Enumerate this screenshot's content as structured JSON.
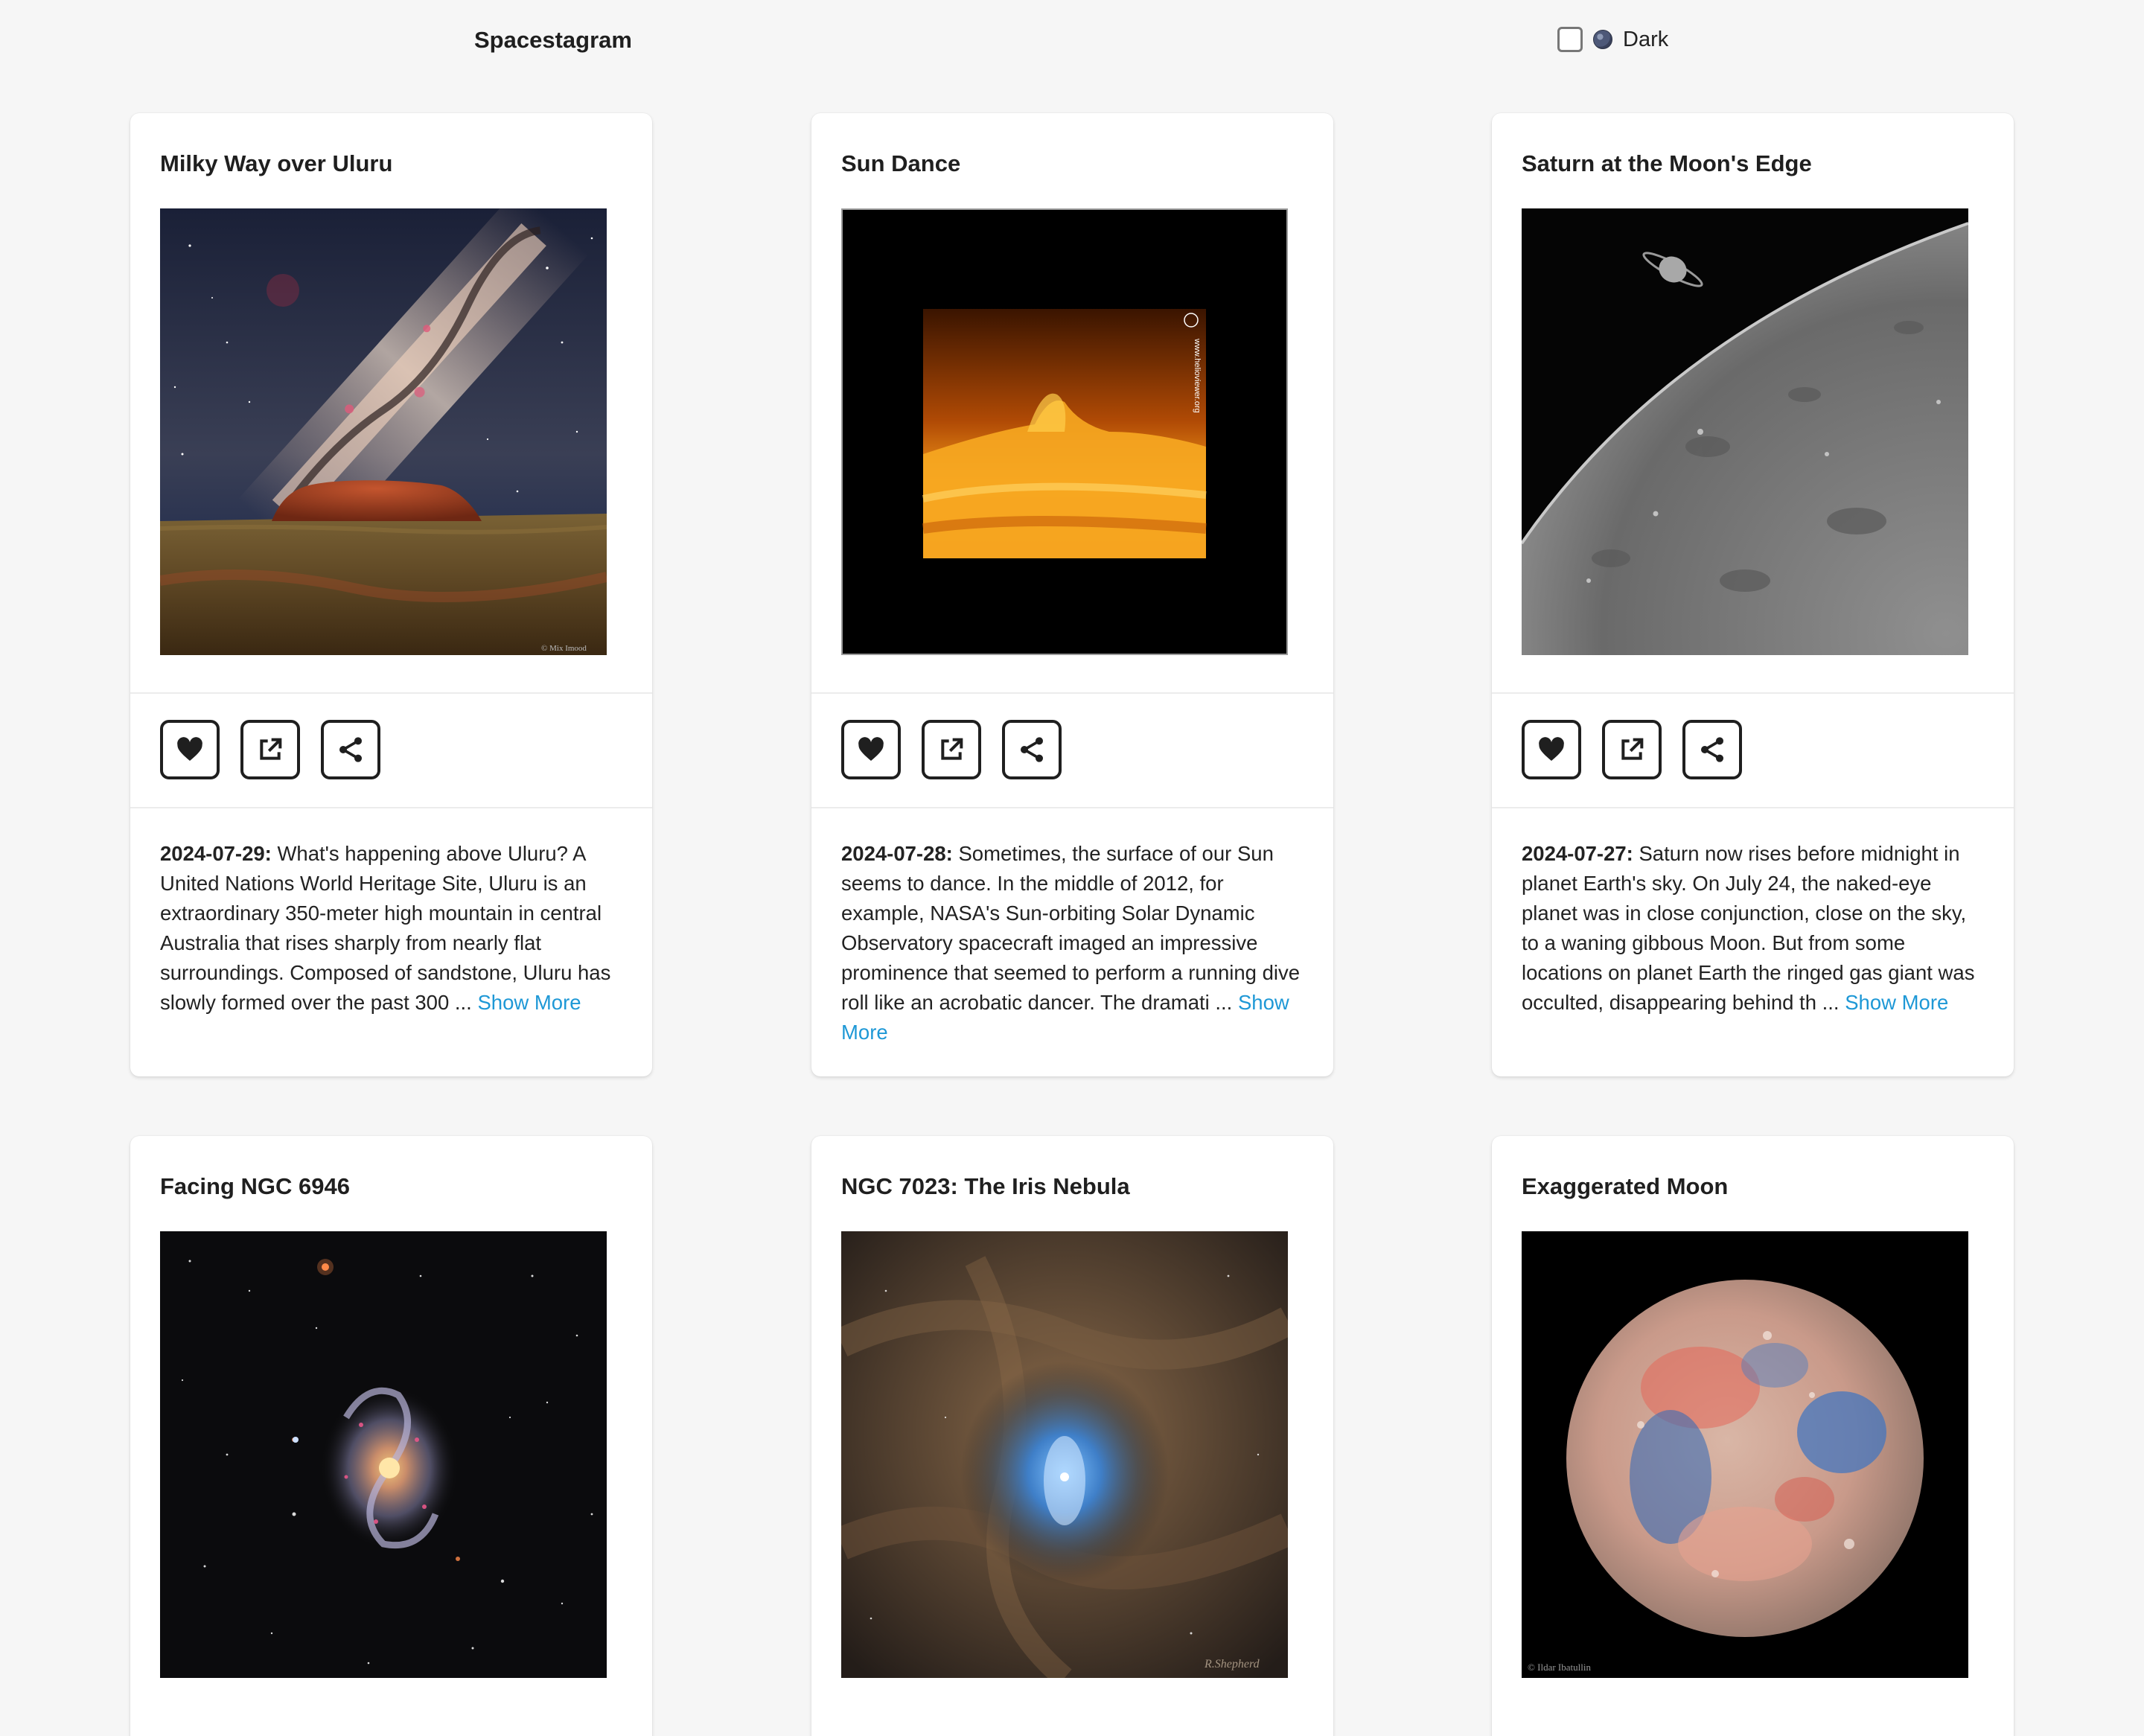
{
  "header": {
    "brand": "Spacestagram",
    "theme_toggle_label": "Dark",
    "theme_icon": "moon-icon"
  },
  "actions": {
    "like_icon": "heart-icon",
    "open_icon": "external-link-icon",
    "share_icon": "share-icon"
  },
  "posts": [
    {
      "title": "Milky Way over Uluru",
      "date": "2024-07-29:",
      "text": "What's happening above Uluru? A United Nations World Heritage Site, Uluru is an extraordinary 350-meter high mountain in central Australia that rises sharply from nearly flat surroundings. Composed of sandstone, Uluru has slowly formed over the past 300 ...",
      "more": "Show More",
      "credit": "© Mix Imood"
    },
    {
      "title": "Sun Dance",
      "date": "2024-07-28:",
      "text": "Sometimes, the surface of our Sun seems to dance. In the middle of 2012, for example, NASA's Sun-orbiting Solar Dynamic Observatory spacecraft imaged an impressive prominence that seemed to perform a running dive roll like an acrobatic dancer. The dramati ...",
      "more": "Show More",
      "credit": "www.helioviewer.org"
    },
    {
      "title": "Saturn at the Moon's Edge",
      "date": "2024-07-27:",
      "text": "Saturn now rises before midnight in planet Earth's sky. On July 24, the naked-eye planet was in close conjunction, close on the sky, to a waning gibbous Moon. But from some locations on planet Earth the ringed gas giant was occulted, disappearing behind th ...",
      "more": "Show More"
    },
    {
      "title": "Facing NGC 6946"
    },
    {
      "title": "NGC 7023: The Iris Nebula",
      "credit": "R.Shepherd"
    },
    {
      "title": "Exaggerated Moon",
      "credit": "© Ildar Ibatullin"
    }
  ]
}
